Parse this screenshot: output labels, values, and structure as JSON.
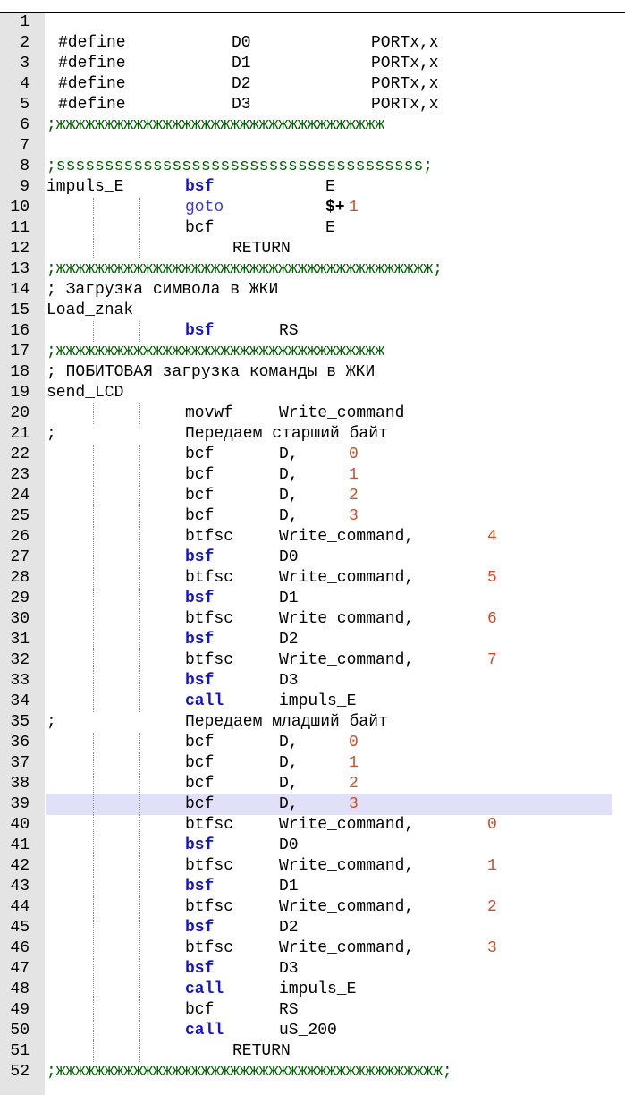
{
  "editor": {
    "title": "",
    "current_line": 39,
    "colors": {
      "keyword": "#1515c8",
      "number": "#c8502a",
      "separator_comment": "#006000",
      "current_line_bg": "#e0e0f8",
      "gutter_bg": "#e4e4e4"
    },
    "lines": [
      {
        "n": "1",
        "tokens": []
      },
      {
        "n": "2",
        "tokens": [
          {
            "t": "#define",
            "c": "plain",
            "col": 1
          },
          {
            "t": "D0",
            "c": "plain",
            "col": 2
          },
          {
            "t": "PORTx,x",
            "c": "plain",
            "col": 3
          }
        ]
      },
      {
        "n": "3",
        "tokens": [
          {
            "t": "#define",
            "c": "plain",
            "col": 1
          },
          {
            "t": "D1",
            "c": "plain",
            "col": 2
          },
          {
            "t": "PORTx,x",
            "c": "plain",
            "col": 3
          }
        ]
      },
      {
        "n": "4",
        "tokens": [
          {
            "t": "#define",
            "c": "plain",
            "col": 1
          },
          {
            "t": "D2",
            "c": "plain",
            "col": 2
          },
          {
            "t": "PORTx,x",
            "c": "plain",
            "col": 3
          }
        ]
      },
      {
        "n": "5",
        "tokens": [
          {
            "t": "#define",
            "c": "plain",
            "col": 1
          },
          {
            "t": "D3",
            "c": "plain",
            "col": 2
          },
          {
            "t": "PORTx,x",
            "c": "plain",
            "col": 3
          }
        ]
      },
      {
        "n": "6",
        "tokens": [
          {
            "t": ";жжжжжжжжжжжжжжжжжжжжжжжжжжжжжжжжжж",
            "c": "cmt",
            "col": 0
          }
        ]
      },
      {
        "n": "7",
        "tokens": []
      },
      {
        "n": "8",
        "tokens": [
          {
            "t": ";ssssssssssssssssssssssssssssssssssssss;",
            "c": "cmt",
            "col": 0
          }
        ]
      },
      {
        "n": "9",
        "tokens": [
          {
            "t": "impuls_E",
            "c": "plain",
            "col": 0
          },
          {
            "t": "bsf",
            "c": "kw",
            "col": 4
          },
          {
            "t": "E",
            "c": "plain",
            "col": 6
          }
        ]
      },
      {
        "n": "10",
        "guides": true,
        "tokens": [
          {
            "t": "goto",
            "c": "goto",
            "col": 4
          },
          {
            "t": "$+",
            "c": "dollar",
            "col": 6
          },
          {
            "t": "1",
            "c": "num",
            "col": 7
          }
        ]
      },
      {
        "n": "11",
        "guides": true,
        "tokens": [
          {
            "t": "bcf",
            "c": "plain",
            "col": 4
          },
          {
            "t": "E",
            "c": "plain",
            "col": 6
          }
        ]
      },
      {
        "n": "12",
        "guides": true,
        "tokens": [
          {
            "t": "RETURN",
            "c": "plain",
            "col": 5
          }
        ]
      },
      {
        "n": "13",
        "tokens": [
          {
            "t": ";жжжжжжжжжжжжжжжжжжжжжжжжжжжжжжжжжжжжжжж;",
            "c": "cmt",
            "col": 0
          }
        ]
      },
      {
        "n": "14",
        "tokens": [
          {
            "t": "; Загрузка символа в ЖКИ",
            "c": "cmtru",
            "col": 0
          }
        ]
      },
      {
        "n": "15",
        "tokens": [
          {
            "t": "Load_znak",
            "c": "plain",
            "col": 0
          }
        ]
      },
      {
        "n": "16",
        "guides": true,
        "tokens": [
          {
            "t": "bsf",
            "c": "kw",
            "col": 4
          },
          {
            "t": "RS",
            "c": "plain",
            "col": 5
          }
        ]
      },
      {
        "n": "17",
        "tokens": [
          {
            "t": ";жжжжжжжжжжжжжжжжжжжжжжжжжжжжжжжжжж",
            "c": "cmt",
            "col": 0
          }
        ]
      },
      {
        "n": "18",
        "tokens": [
          {
            "t": "; ПОБИТОВАЯ загрузка команды в ЖКИ",
            "c": "cmtru",
            "col": 0
          }
        ]
      },
      {
        "n": "19",
        "tokens": [
          {
            "t": "send_LCD",
            "c": "plain",
            "col": 0
          }
        ]
      },
      {
        "n": "20",
        "guides": true,
        "tokens": [
          {
            "t": "movwf",
            "c": "plain",
            "col": 4
          },
          {
            "t": "Write_command",
            "c": "plain",
            "col": 5
          }
        ]
      },
      {
        "n": "21",
        "tokens": [
          {
            "t": ";",
            "c": "cmtru",
            "col": 0
          },
          {
            "t": "Передаем старший байт",
            "c": "cmtru",
            "col": 4
          }
        ]
      },
      {
        "n": "22",
        "guides": true,
        "tokens": [
          {
            "t": "bcf",
            "c": "plain",
            "col": 4
          },
          {
            "t": "D,",
            "c": "plain",
            "col": 5
          },
          {
            "t": "0",
            "c": "num",
            "col": 8
          }
        ]
      },
      {
        "n": "23",
        "guides": true,
        "tokens": [
          {
            "t": "bcf",
            "c": "plain",
            "col": 4
          },
          {
            "t": "D,",
            "c": "plain",
            "col": 5
          },
          {
            "t": "1",
            "c": "num",
            "col": 8
          }
        ]
      },
      {
        "n": "24",
        "guides": true,
        "tokens": [
          {
            "t": "bcf",
            "c": "plain",
            "col": 4
          },
          {
            "t": "D,",
            "c": "plain",
            "col": 5
          },
          {
            "t": "2",
            "c": "num",
            "col": 8
          }
        ]
      },
      {
        "n": "25",
        "guides": true,
        "tokens": [
          {
            "t": "bcf",
            "c": "plain",
            "col": 4
          },
          {
            "t": "D,",
            "c": "plain",
            "col": 5
          },
          {
            "t": "3",
            "c": "num",
            "col": 8
          }
        ]
      },
      {
        "n": "26",
        "guides": true,
        "tokens": [
          {
            "t": "btfsc",
            "c": "plain",
            "col": 4
          },
          {
            "t": "Write_command,",
            "c": "plain",
            "col": 5
          },
          {
            "t": "4",
            "c": "num",
            "col": 9
          }
        ]
      },
      {
        "n": "27",
        "guides": true,
        "tokens": [
          {
            "t": "bsf",
            "c": "kw",
            "col": 4
          },
          {
            "t": "D0",
            "c": "plain",
            "col": 5
          }
        ]
      },
      {
        "n": "28",
        "guides": true,
        "tokens": [
          {
            "t": "btfsc",
            "c": "plain",
            "col": 4
          },
          {
            "t": "Write_command,",
            "c": "plain",
            "col": 5
          },
          {
            "t": "5",
            "c": "num",
            "col": 9
          }
        ]
      },
      {
        "n": "29",
        "guides": true,
        "tokens": [
          {
            "t": "bsf",
            "c": "kw",
            "col": 4
          },
          {
            "t": "D1",
            "c": "plain",
            "col": 5
          }
        ]
      },
      {
        "n": "30",
        "guides": true,
        "tokens": [
          {
            "t": "btfsc",
            "c": "plain",
            "col": 4
          },
          {
            "t": "Write_command,",
            "c": "plain",
            "col": 5
          },
          {
            "t": "6",
            "c": "num",
            "col": 9
          }
        ]
      },
      {
        "n": "31",
        "guides": true,
        "tokens": [
          {
            "t": "bsf",
            "c": "kw",
            "col": 4
          },
          {
            "t": "D2",
            "c": "plain",
            "col": 5
          }
        ]
      },
      {
        "n": "32",
        "guides": true,
        "tokens": [
          {
            "t": "btfsc",
            "c": "plain",
            "col": 4
          },
          {
            "t": "Write_command,",
            "c": "plain",
            "col": 5
          },
          {
            "t": "7",
            "c": "num",
            "col": 9
          }
        ]
      },
      {
        "n": "33",
        "guides": true,
        "tokens": [
          {
            "t": "bsf",
            "c": "kw",
            "col": 4
          },
          {
            "t": "D3",
            "c": "plain",
            "col": 5
          }
        ]
      },
      {
        "n": "34",
        "guides": true,
        "tokens": [
          {
            "t": "call",
            "c": "kw",
            "col": 4
          },
          {
            "t": "impuls_E",
            "c": "plain",
            "col": 5
          }
        ]
      },
      {
        "n": "35",
        "tokens": [
          {
            "t": ";",
            "c": "cmtru",
            "col": 0
          },
          {
            "t": "Передаем младший байт",
            "c": "cmtru",
            "col": 4
          }
        ]
      },
      {
        "n": "36",
        "guides": true,
        "tokens": [
          {
            "t": "bcf",
            "c": "plain",
            "col": 4
          },
          {
            "t": "D,",
            "c": "plain",
            "col": 5
          },
          {
            "t": "0",
            "c": "num",
            "col": 8
          }
        ]
      },
      {
        "n": "37",
        "guides": true,
        "tokens": [
          {
            "t": "bcf",
            "c": "plain",
            "col": 4
          },
          {
            "t": "D,",
            "c": "plain",
            "col": 5
          },
          {
            "t": "1",
            "c": "num",
            "col": 8
          }
        ]
      },
      {
        "n": "38",
        "guides": true,
        "tokens": [
          {
            "t": "bcf",
            "c": "plain",
            "col": 4
          },
          {
            "t": "D,",
            "c": "plain",
            "col": 5
          },
          {
            "t": "2",
            "c": "num",
            "col": 8
          }
        ]
      },
      {
        "n": "39",
        "guides": true,
        "tokens": [
          {
            "t": "bcf",
            "c": "plain",
            "col": 4
          },
          {
            "t": "D,",
            "c": "plain",
            "col": 5
          },
          {
            "t": "3",
            "c": "num",
            "col": 8
          }
        ]
      },
      {
        "n": "40",
        "guides": true,
        "tokens": [
          {
            "t": "btfsc",
            "c": "plain",
            "col": 4
          },
          {
            "t": "Write_command,",
            "c": "plain",
            "col": 5
          },
          {
            "t": "0",
            "c": "num",
            "col": 9
          }
        ]
      },
      {
        "n": "41",
        "guides": true,
        "tokens": [
          {
            "t": "bsf",
            "c": "kw",
            "col": 4
          },
          {
            "t": "D0",
            "c": "plain",
            "col": 5
          }
        ]
      },
      {
        "n": "42",
        "guides": true,
        "tokens": [
          {
            "t": "btfsc",
            "c": "plain",
            "col": 4
          },
          {
            "t": "Write_command,",
            "c": "plain",
            "col": 5
          },
          {
            "t": "1",
            "c": "num",
            "col": 9
          }
        ]
      },
      {
        "n": "43",
        "guides": true,
        "tokens": [
          {
            "t": "bsf",
            "c": "kw",
            "col": 4
          },
          {
            "t": "D1",
            "c": "plain",
            "col": 5
          }
        ]
      },
      {
        "n": "44",
        "guides": true,
        "tokens": [
          {
            "t": "btfsc",
            "c": "plain",
            "col": 4
          },
          {
            "t": "Write_command,",
            "c": "plain",
            "col": 5
          },
          {
            "t": "2",
            "c": "num",
            "col": 9
          }
        ]
      },
      {
        "n": "45",
        "guides": true,
        "tokens": [
          {
            "t": "bsf",
            "c": "kw",
            "col": 4
          },
          {
            "t": "D2",
            "c": "plain",
            "col": 5
          }
        ]
      },
      {
        "n": "46",
        "guides": true,
        "tokens": [
          {
            "t": "btfsc",
            "c": "plain",
            "col": 4
          },
          {
            "t": "Write_command,",
            "c": "plain",
            "col": 5
          },
          {
            "t": "3",
            "c": "num",
            "col": 9
          }
        ]
      },
      {
        "n": "47",
        "guides": true,
        "tokens": [
          {
            "t": "bsf",
            "c": "kw",
            "col": 4
          },
          {
            "t": "D3",
            "c": "plain",
            "col": 5
          }
        ]
      },
      {
        "n": "48",
        "guides": true,
        "tokens": [
          {
            "t": "call",
            "c": "kw",
            "col": 4
          },
          {
            "t": "impuls_E",
            "c": "plain",
            "col": 5
          }
        ]
      },
      {
        "n": "49",
        "guides": true,
        "tokens": [
          {
            "t": "bcf",
            "c": "plain",
            "col": 4
          },
          {
            "t": "RS",
            "c": "plain",
            "col": 5
          }
        ]
      },
      {
        "n": "50",
        "guides": true,
        "tokens": [
          {
            "t": "call",
            "c": "kw",
            "col": 4
          },
          {
            "t": "uS_200",
            "c": "plain",
            "col": 5
          }
        ]
      },
      {
        "n": "51",
        "guides": true,
        "tokens": [
          {
            "t": "RETURN",
            "c": "plain",
            "col": 5
          }
        ]
      },
      {
        "n": "52",
        "tokens": [
          {
            "t": ";жжжжжжжжжжжжжжжжжжжжжжжжжжжжжжжжжжжжжжжж;",
            "c": "cmt",
            "col": 0
          }
        ]
      }
    ]
  }
}
